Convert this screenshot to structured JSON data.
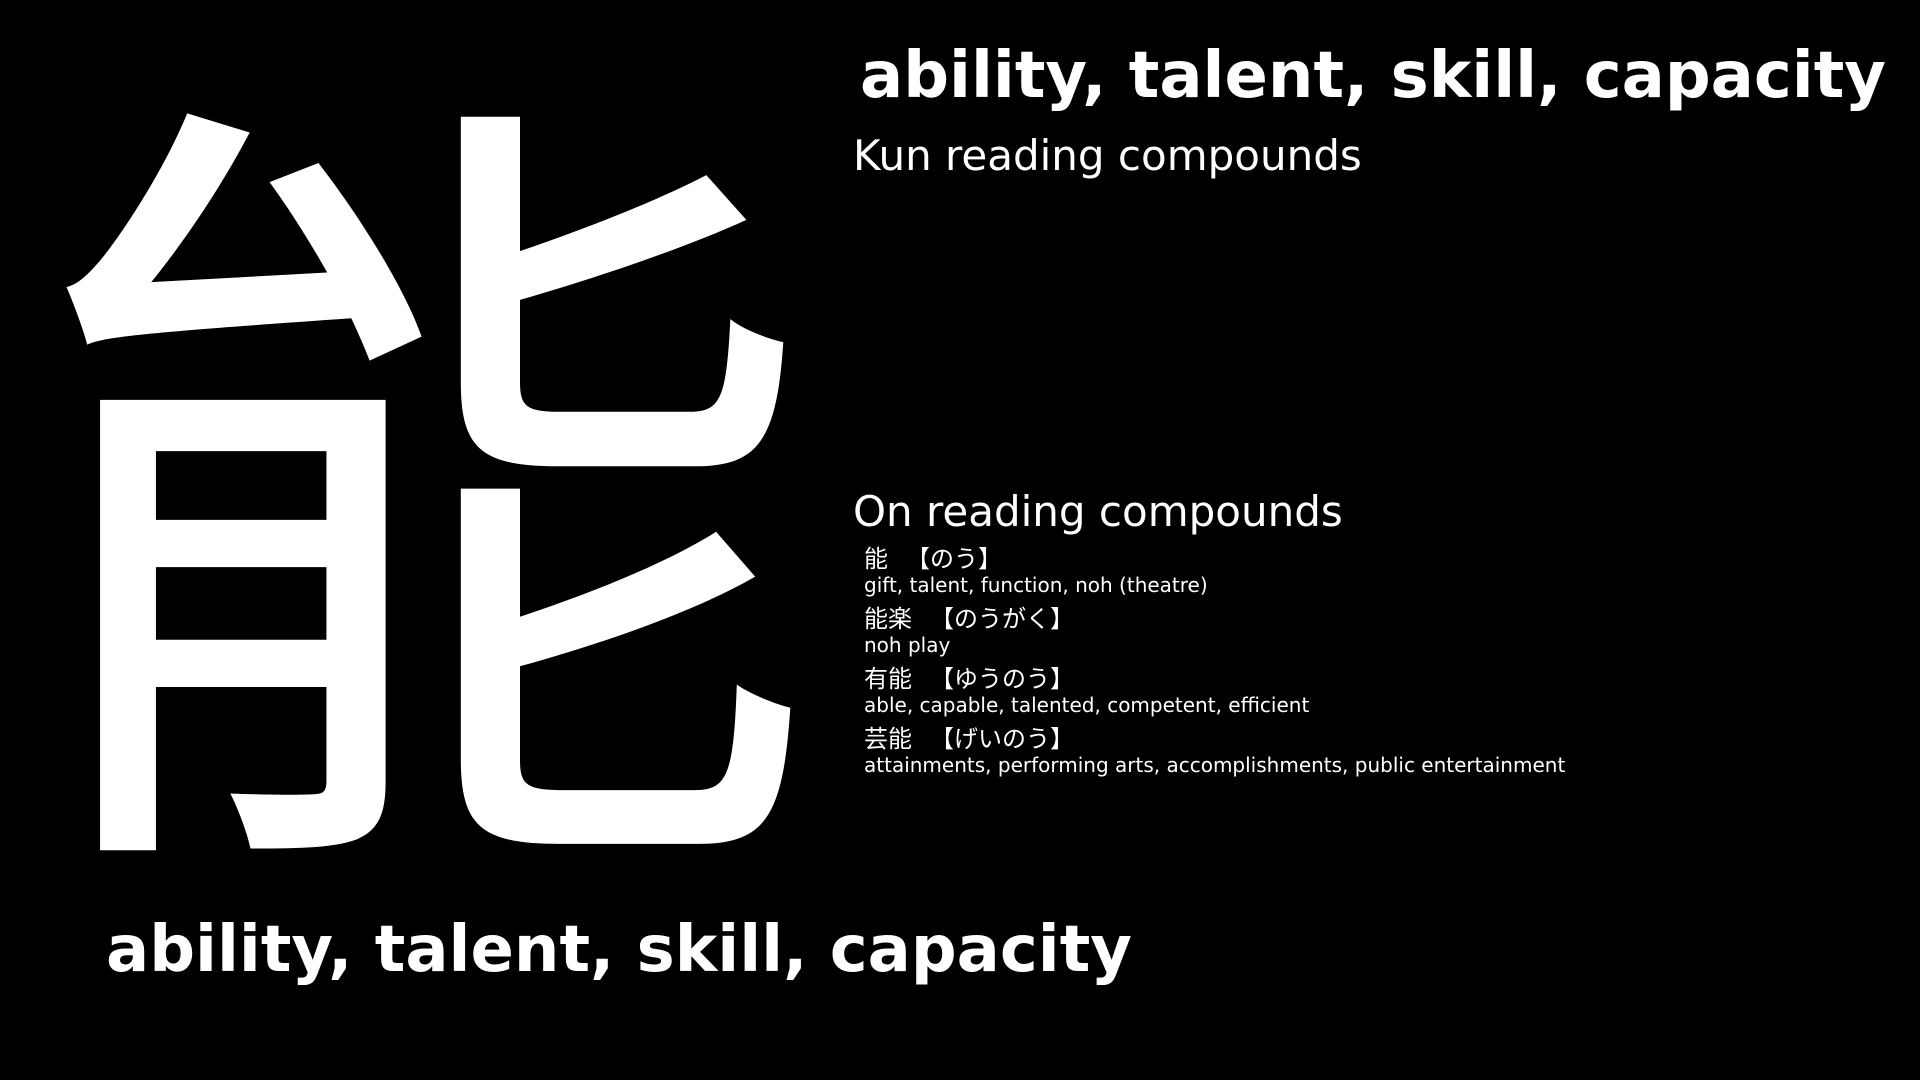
{
  "kanji": {
    "character": "能",
    "meaning": "ability, talent, skill, capacity"
  },
  "header": {
    "title": "ability, talent, skill, capacity"
  },
  "kun_section": {
    "heading": "Kun reading compounds",
    "compounds": []
  },
  "on_section": {
    "heading": "On reading compounds",
    "compounds": [
      {
        "word": "能",
        "reading": "【のう】",
        "meaning": "gift, talent, function, noh (theatre)"
      },
      {
        "word": "能楽",
        "reading": "【のうがく】",
        "meaning": "noh play"
      },
      {
        "word": "有能",
        "reading": "【ゆうのう】",
        "meaning": "able, capable, talented, competent, efficient"
      },
      {
        "word": "芸能",
        "reading": "【げいのう】",
        "meaning": "attainments, performing arts, accomplishments, public entertainment"
      }
    ]
  },
  "colors": {
    "background": "#000000",
    "text": "#ffffff"
  }
}
